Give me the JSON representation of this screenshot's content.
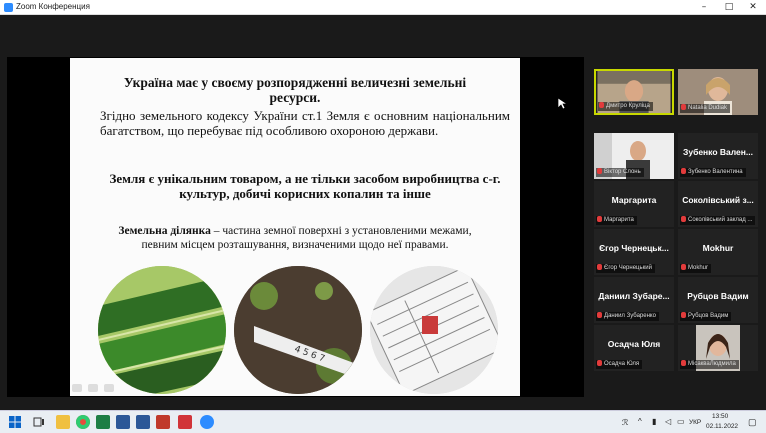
{
  "window": {
    "title": "Zoom Конференция"
  },
  "colors": {
    "active_speaker": "#c8d800",
    "muted": "#e23b3b",
    "zoom_blue": "#2d8cff"
  },
  "slide": {
    "heading1": "Україна має у своєму розпорядженні величезні земельні ресурси.",
    "paragraph1": "Згідно земельного кодексу України ст.1 Земля є основним національним багатством, що перебуває під особливою охороною держави.",
    "heading2": "Земля є унікальним товаром, а не тільки засобом виробництва с-г. культур, добичі корисних копалин та інше",
    "term": "Земельна ділянка",
    "definition": " – частина земної поверхні з установленими межами, певним місцем розташування, визначеними щодо неї правами."
  },
  "participants": [
    {
      "display": "",
      "label": "Дмитро Круліца",
      "video": true,
      "active": true
    },
    {
      "display": "",
      "label": "Natalia Dudiak",
      "video": true
    },
    {
      "display": "",
      "label": "Віктор Слонь",
      "video": true
    },
    {
      "display": "Зубенко Вален...",
      "label": "Зубенко Валентина"
    },
    {
      "display": "Маргарита",
      "label": "Маргарита"
    },
    {
      "display": "Соколівський з...",
      "label": "Соколівський заклад ..."
    },
    {
      "display": "Єгор Чернецьк...",
      "label": "Єгор Чернецький"
    },
    {
      "display": "Mokhur",
      "label": "Mokhur"
    },
    {
      "display": "Даниил Зубаре...",
      "label": "Даниил Зубаренко"
    },
    {
      "display": "Рубцов Вадим",
      "label": "Рубцов Вадим"
    },
    {
      "display": "Осадча Юля",
      "label": "Осадча Юля"
    },
    {
      "display": "",
      "label": "МісакваЛюдмила",
      "video": true
    }
  ],
  "taskbar": {
    "language": "УКР",
    "time": "13:50",
    "date": "02.11.2022"
  }
}
